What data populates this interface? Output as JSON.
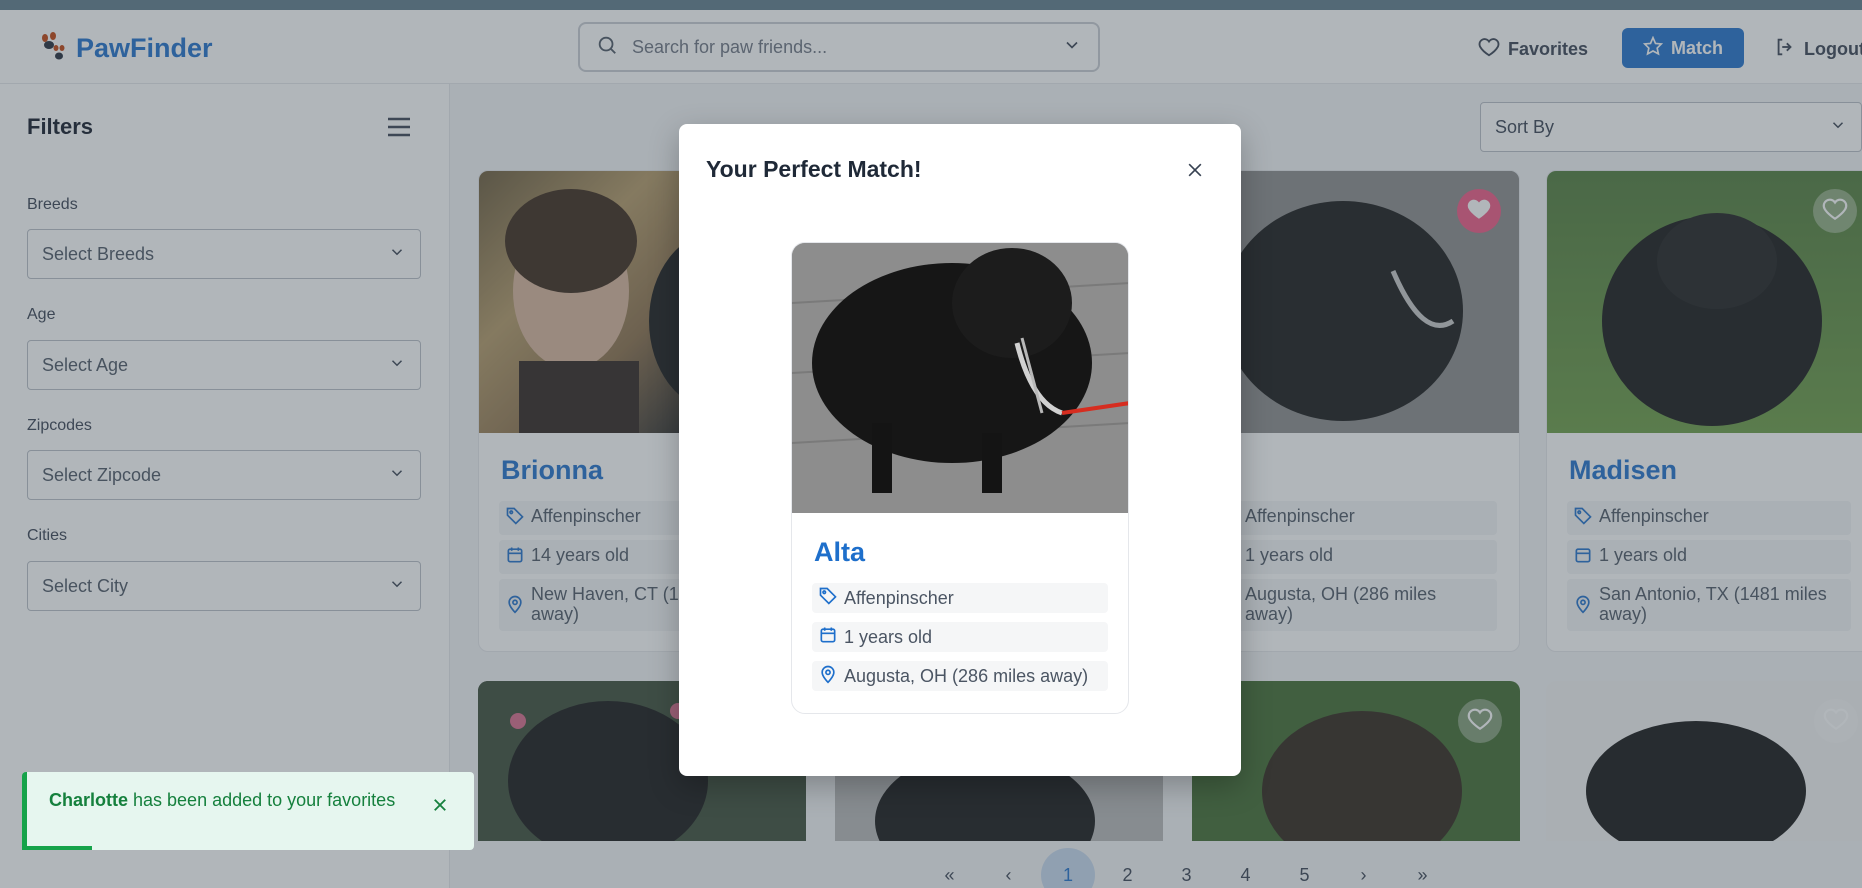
{
  "app": {
    "name": "PawFinder"
  },
  "header": {
    "search_placeholder": "Search for paw friends...",
    "favorites_label": "Favorites",
    "match_label": "Match",
    "logout_label": "Logout"
  },
  "sidebar": {
    "title": "Filters",
    "filters": [
      {
        "label": "Breeds",
        "placeholder": "Select Breeds"
      },
      {
        "label": "Age",
        "placeholder": "Select Age"
      },
      {
        "label": "Zipcodes",
        "placeholder": "Select Zipcode"
      },
      {
        "label": "Cities",
        "placeholder": "Select City"
      }
    ]
  },
  "main": {
    "sort_label": "Sort By",
    "cards": [
      {
        "name": "Brionna",
        "breed": "Affenpinscher",
        "age": "14 years old",
        "location": "New Haven, CT (1",
        "location2": "away)",
        "favorited": false
      },
      {
        "name": "ta",
        "breed": "Affenpinscher",
        "age": "1 years old",
        "location": "Augusta, OH (286 miles",
        "location2": "away)",
        "favorited": true
      },
      {
        "name": "Madisen",
        "breed": "Affenpinscher",
        "age": "1 years old",
        "location": "San Antonio, TX (1481 miles",
        "location2": "away)",
        "favorited": false
      }
    ],
    "pagination": [
      "«",
      "‹",
      "1",
      "2",
      "3",
      "4",
      "5",
      "›",
      "»"
    ],
    "current_page": "1"
  },
  "toast": {
    "name": "Charlotte",
    "message": " has been added to your favorites"
  },
  "modal": {
    "title": "Your Perfect Match!",
    "dog": {
      "name": "Alta",
      "breed": "Affenpinscher",
      "age": "1 years old",
      "location": "Augusta, OH (286 miles away)"
    }
  },
  "colors": {
    "brand": "#1e6fcb",
    "favorite": "#ef5683",
    "success": "#16a34a"
  }
}
